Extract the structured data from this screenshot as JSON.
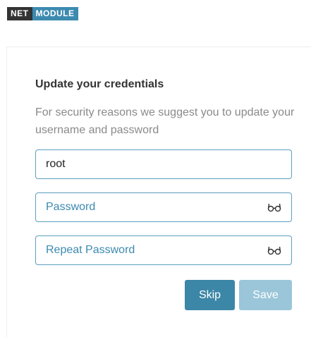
{
  "logo": {
    "part1": "NET",
    "part2": "MODULE"
  },
  "form": {
    "title": "Update your credentials",
    "description": "For security reasons we suggest you to update your username and password",
    "username_value": "root",
    "password_placeholder": "Password",
    "repeat_password_placeholder": "Repeat Password",
    "skip_label": "Skip",
    "save_label": "Save"
  },
  "icons": {
    "password_toggle": "glasses-icon",
    "repeat_toggle": "glasses-icon"
  },
  "colors": {
    "brand_dark": "#333333",
    "brand_accent": "#3c8ab0",
    "skip_button": "#3c86a7",
    "save_button_disabled": "#9bc6d9",
    "input_border": "#5b9fbf"
  }
}
